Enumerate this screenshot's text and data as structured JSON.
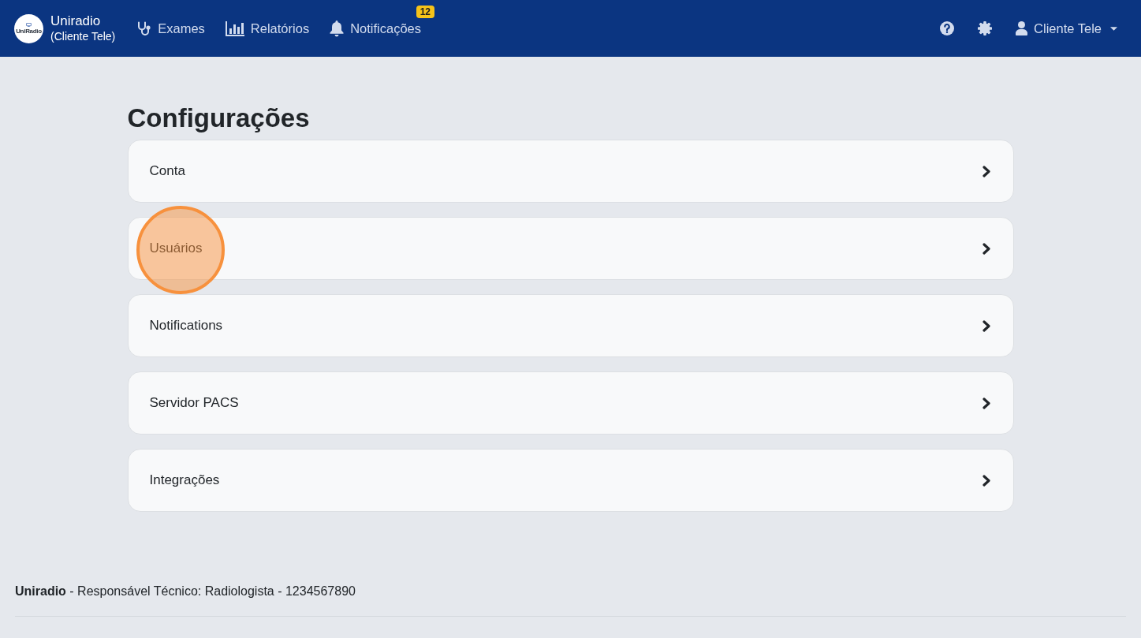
{
  "navbar": {
    "logo_text": "UniRadio",
    "brand": {
      "name": "Uniradio",
      "subtitle": "(Cliente Tele)"
    },
    "links": [
      {
        "kind": "exams",
        "label": "Exames"
      },
      {
        "kind": "reports",
        "label": "Relatórios"
      },
      {
        "kind": "notifications",
        "label": "Notificações",
        "badge": "12"
      }
    ],
    "user_menu": {
      "label": "Cliente Tele"
    }
  },
  "page": {
    "title": "Configurações",
    "items": [
      {
        "label": "Conta",
        "cursor_highlight": false
      },
      {
        "label": "Usuários",
        "cursor_highlight": true
      },
      {
        "label": "Notifications",
        "cursor_highlight": false
      },
      {
        "label": "Servidor PACS",
        "cursor_highlight": false
      },
      {
        "label": "Integrações",
        "cursor_highlight": false
      }
    ]
  },
  "footer": {
    "credit": "**Uniradio** - Responsável Técnico: Radiologista - 1234567890"
  }
}
